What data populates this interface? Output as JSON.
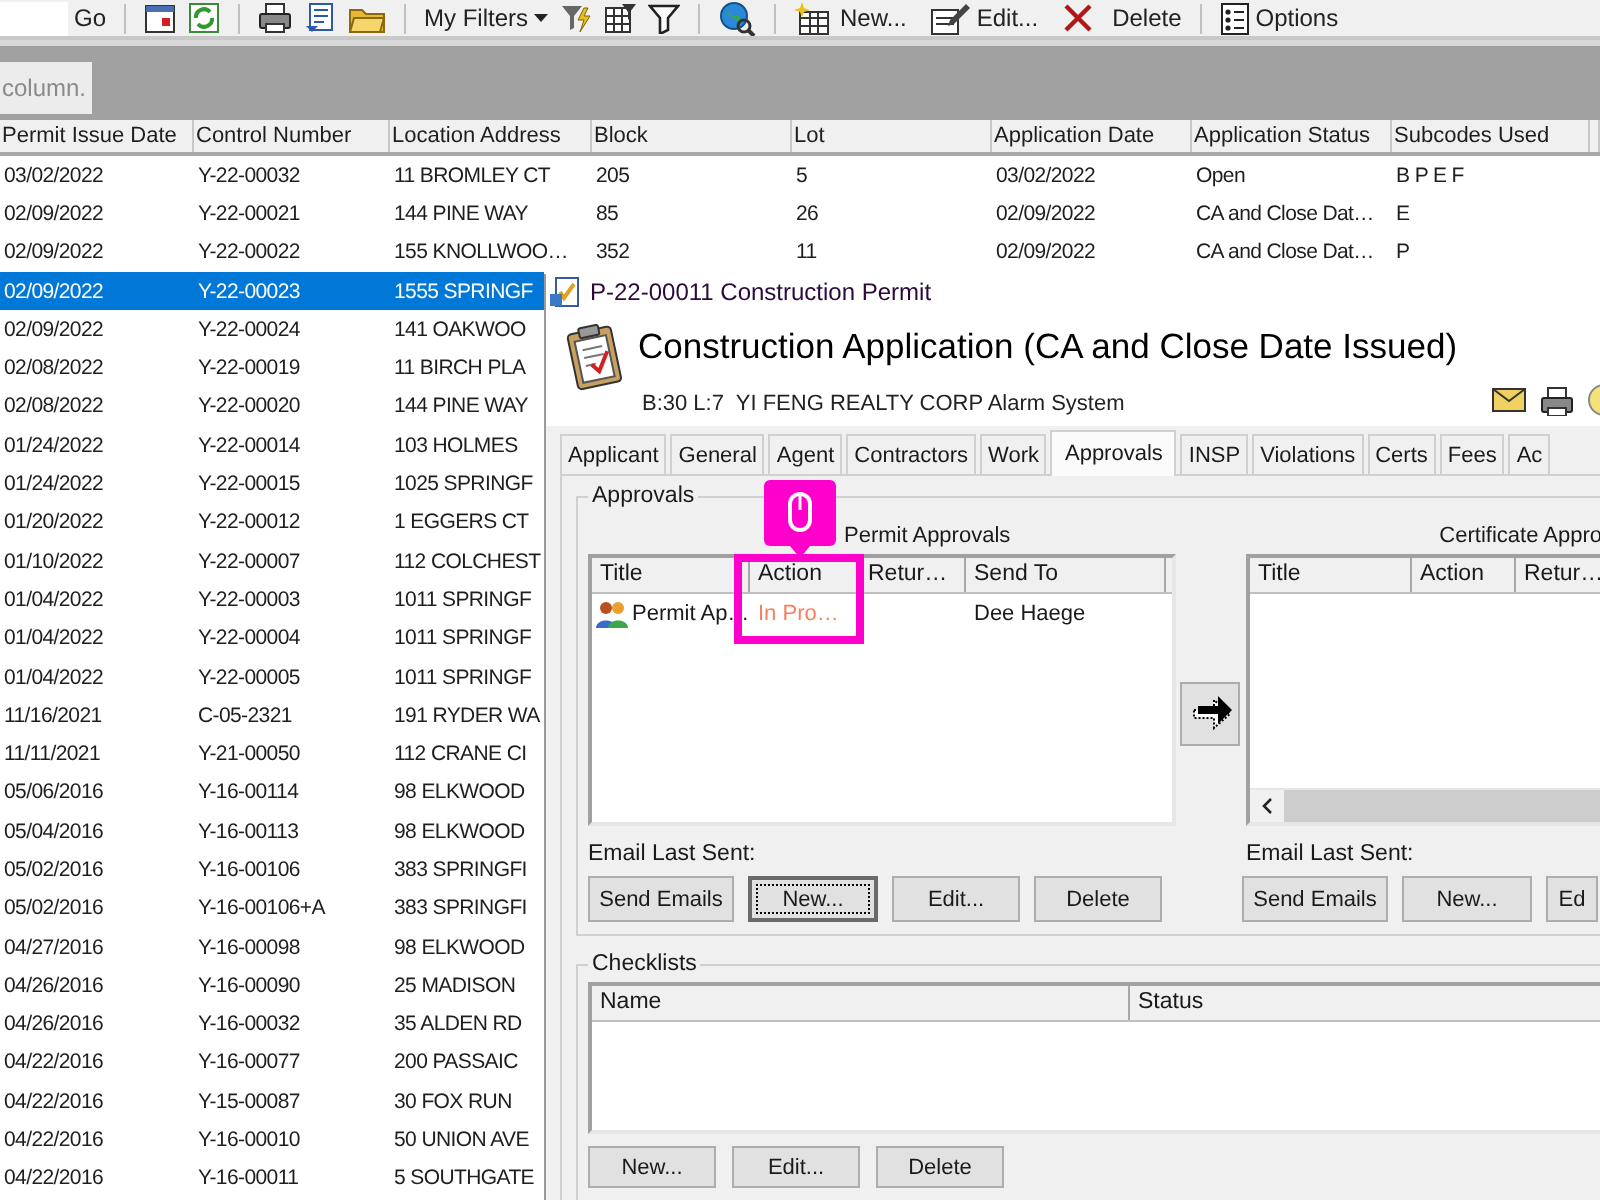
{
  "toolbar": {
    "go": "Go",
    "filters": "My Filters",
    "new": "New...",
    "edit": "Edit...",
    "delete": "Delete",
    "options": "Options"
  },
  "group_hint": "column.",
  "table": {
    "columns": [
      "Permit Issue Date",
      "Control Number",
      "Location Address",
      "Block",
      "Lot",
      "Application Date",
      "Application Status",
      "Subcodes Used"
    ],
    "rows": [
      {
        "cells": [
          "03/02/2022",
          "Y-22-00032",
          "11 BROMLEY CT",
          "205",
          "5",
          "03/02/2022",
          "Open",
          "B P E F"
        ],
        "selected": false
      },
      {
        "cells": [
          "02/09/2022",
          "Y-22-00021",
          "144 PINE WAY",
          "85",
          "26",
          "02/09/2022",
          "CA and Close Dat…",
          "E"
        ],
        "selected": false
      },
      {
        "cells": [
          "02/09/2022",
          "Y-22-00022",
          "155 KNOLLWOO…",
          "352",
          "11",
          "02/09/2022",
          "CA and Close Dat…",
          "P"
        ],
        "selected": false
      },
      {
        "cells": [
          "02/09/2022",
          "Y-22-00023",
          "1555 SPRINGF"
        ],
        "selected": true
      },
      {
        "cells": [
          "02/09/2022",
          "Y-22-00024",
          "141 OAKWOO"
        ],
        "selected": false
      },
      {
        "cells": [
          "02/08/2022",
          "Y-22-00019",
          "11 BIRCH PLA"
        ],
        "selected": false
      },
      {
        "cells": [
          "02/08/2022",
          "Y-22-00020",
          "144 PINE WAY"
        ],
        "selected": false
      },
      {
        "cells": [
          "01/24/2022",
          "Y-22-00014",
          "103 HOLMES"
        ],
        "selected": false
      },
      {
        "cells": [
          "01/24/2022",
          "Y-22-00015",
          "1025 SPRINGF"
        ],
        "selected": false
      },
      {
        "cells": [
          "01/20/2022",
          "Y-22-00012",
          "1 EGGERS CT"
        ],
        "selected": false
      },
      {
        "cells": [
          "01/10/2022",
          "Y-22-00007",
          "112 COLCHEST"
        ],
        "selected": false
      },
      {
        "cells": [
          "01/04/2022",
          "Y-22-00003",
          "1011 SPRINGF"
        ],
        "selected": false
      },
      {
        "cells": [
          "01/04/2022",
          "Y-22-00004",
          "1011 SPRINGF"
        ],
        "selected": false
      },
      {
        "cells": [
          "01/04/2022",
          "Y-22-00005",
          "1011 SPRINGF"
        ],
        "selected": false
      },
      {
        "cells": [
          "11/16/2021",
          "C-05-2321",
          "191 RYDER WA"
        ],
        "selected": false
      },
      {
        "cells": [
          "11/11/2021",
          "Y-21-00050",
          "112 CRANE CI"
        ],
        "selected": false
      },
      {
        "cells": [
          "05/06/2016",
          "Y-16-00114",
          "98 ELKWOOD"
        ],
        "selected": false
      },
      {
        "cells": [
          "05/04/2016",
          "Y-16-00113",
          "98 ELKWOOD"
        ],
        "selected": false
      },
      {
        "cells": [
          "05/02/2016",
          "Y-16-00106",
          "383 SPRINGFI"
        ],
        "selected": false
      },
      {
        "cells": [
          "05/02/2016",
          "Y-16-00106+A",
          "383 SPRINGFI"
        ],
        "selected": false
      },
      {
        "cells": [
          "04/27/2016",
          "Y-16-00098",
          "98 ELKWOOD"
        ],
        "selected": false
      },
      {
        "cells": [
          "04/26/2016",
          "Y-16-00090",
          "25 MADISON"
        ],
        "selected": false
      },
      {
        "cells": [
          "04/26/2016",
          "Y-16-00032",
          "35 ALDEN RD"
        ],
        "selected": false
      },
      {
        "cells": [
          "04/22/2016",
          "Y-16-00077",
          "200 PASSAIC"
        ],
        "selected": false
      },
      {
        "cells": [
          "04/22/2016",
          "Y-15-00087",
          "30 FOX RUN"
        ],
        "selected": false
      },
      {
        "cells": [
          "04/22/2016",
          "Y-16-00010",
          "50 UNION AVE"
        ],
        "selected": false
      },
      {
        "cells": [
          "04/22/2016",
          "Y-16-00011",
          "5 SOUTHGATE"
        ],
        "selected": false
      }
    ]
  },
  "dialog": {
    "title": "P-22-00011 Construction Permit",
    "heading": "Construction Application (CA and Close Date Issued)",
    "subheading": "B:30 L:7  YI FENG REALTY CORP Alarm System",
    "tabs": [
      {
        "label": "Applicant",
        "selected": false
      },
      {
        "label": "General",
        "selected": false
      },
      {
        "label": "Agent",
        "selected": false
      },
      {
        "label": "Contractors",
        "selected": false
      },
      {
        "label": "Work",
        "selected": false
      },
      {
        "label": "Approvals",
        "selected": true
      },
      {
        "label": "INSP",
        "selected": false
      },
      {
        "label": "Violations",
        "selected": false
      },
      {
        "label": "Certs",
        "selected": false
      },
      {
        "label": "Fees",
        "selected": false
      },
      {
        "label": "Ac",
        "selected": false
      }
    ],
    "approvals": {
      "legend": "Approvals",
      "permit": {
        "label": "Permit Approvals",
        "columns": [
          "Title",
          "Action",
          "Retur…",
          "Send To"
        ],
        "rows": [
          {
            "title": "Permit Ap…",
            "action": "In Pro…",
            "send_to": "Dee Haege",
            "color": "#f4805c"
          }
        ],
        "email_label": "Email Last Sent:",
        "buttons": [
          {
            "label": "Send Emails",
            "focused": false
          },
          {
            "label": "New...",
            "focused": true
          },
          {
            "label": "Edit...",
            "focused": false
          },
          {
            "label": "Delete",
            "focused": false
          }
        ]
      },
      "certificate": {
        "label": "Certificate Appro",
        "columns": [
          "Title",
          "Action",
          "Retur…"
        ],
        "email_label": "Email Last Sent:",
        "buttons": [
          {
            "label": "Send Emails",
            "focused": false
          },
          {
            "label": "New...",
            "focused": false
          },
          {
            "label": "Ed",
            "focused": false
          }
        ]
      }
    },
    "checklists": {
      "legend": "Checklists",
      "columns": [
        "Name",
        "Status"
      ],
      "buttons": [
        {
          "label": "New...",
          "focused": false
        },
        {
          "label": "Edit...",
          "focused": false
        },
        {
          "label": "Delete",
          "focused": false
        }
      ]
    }
  }
}
